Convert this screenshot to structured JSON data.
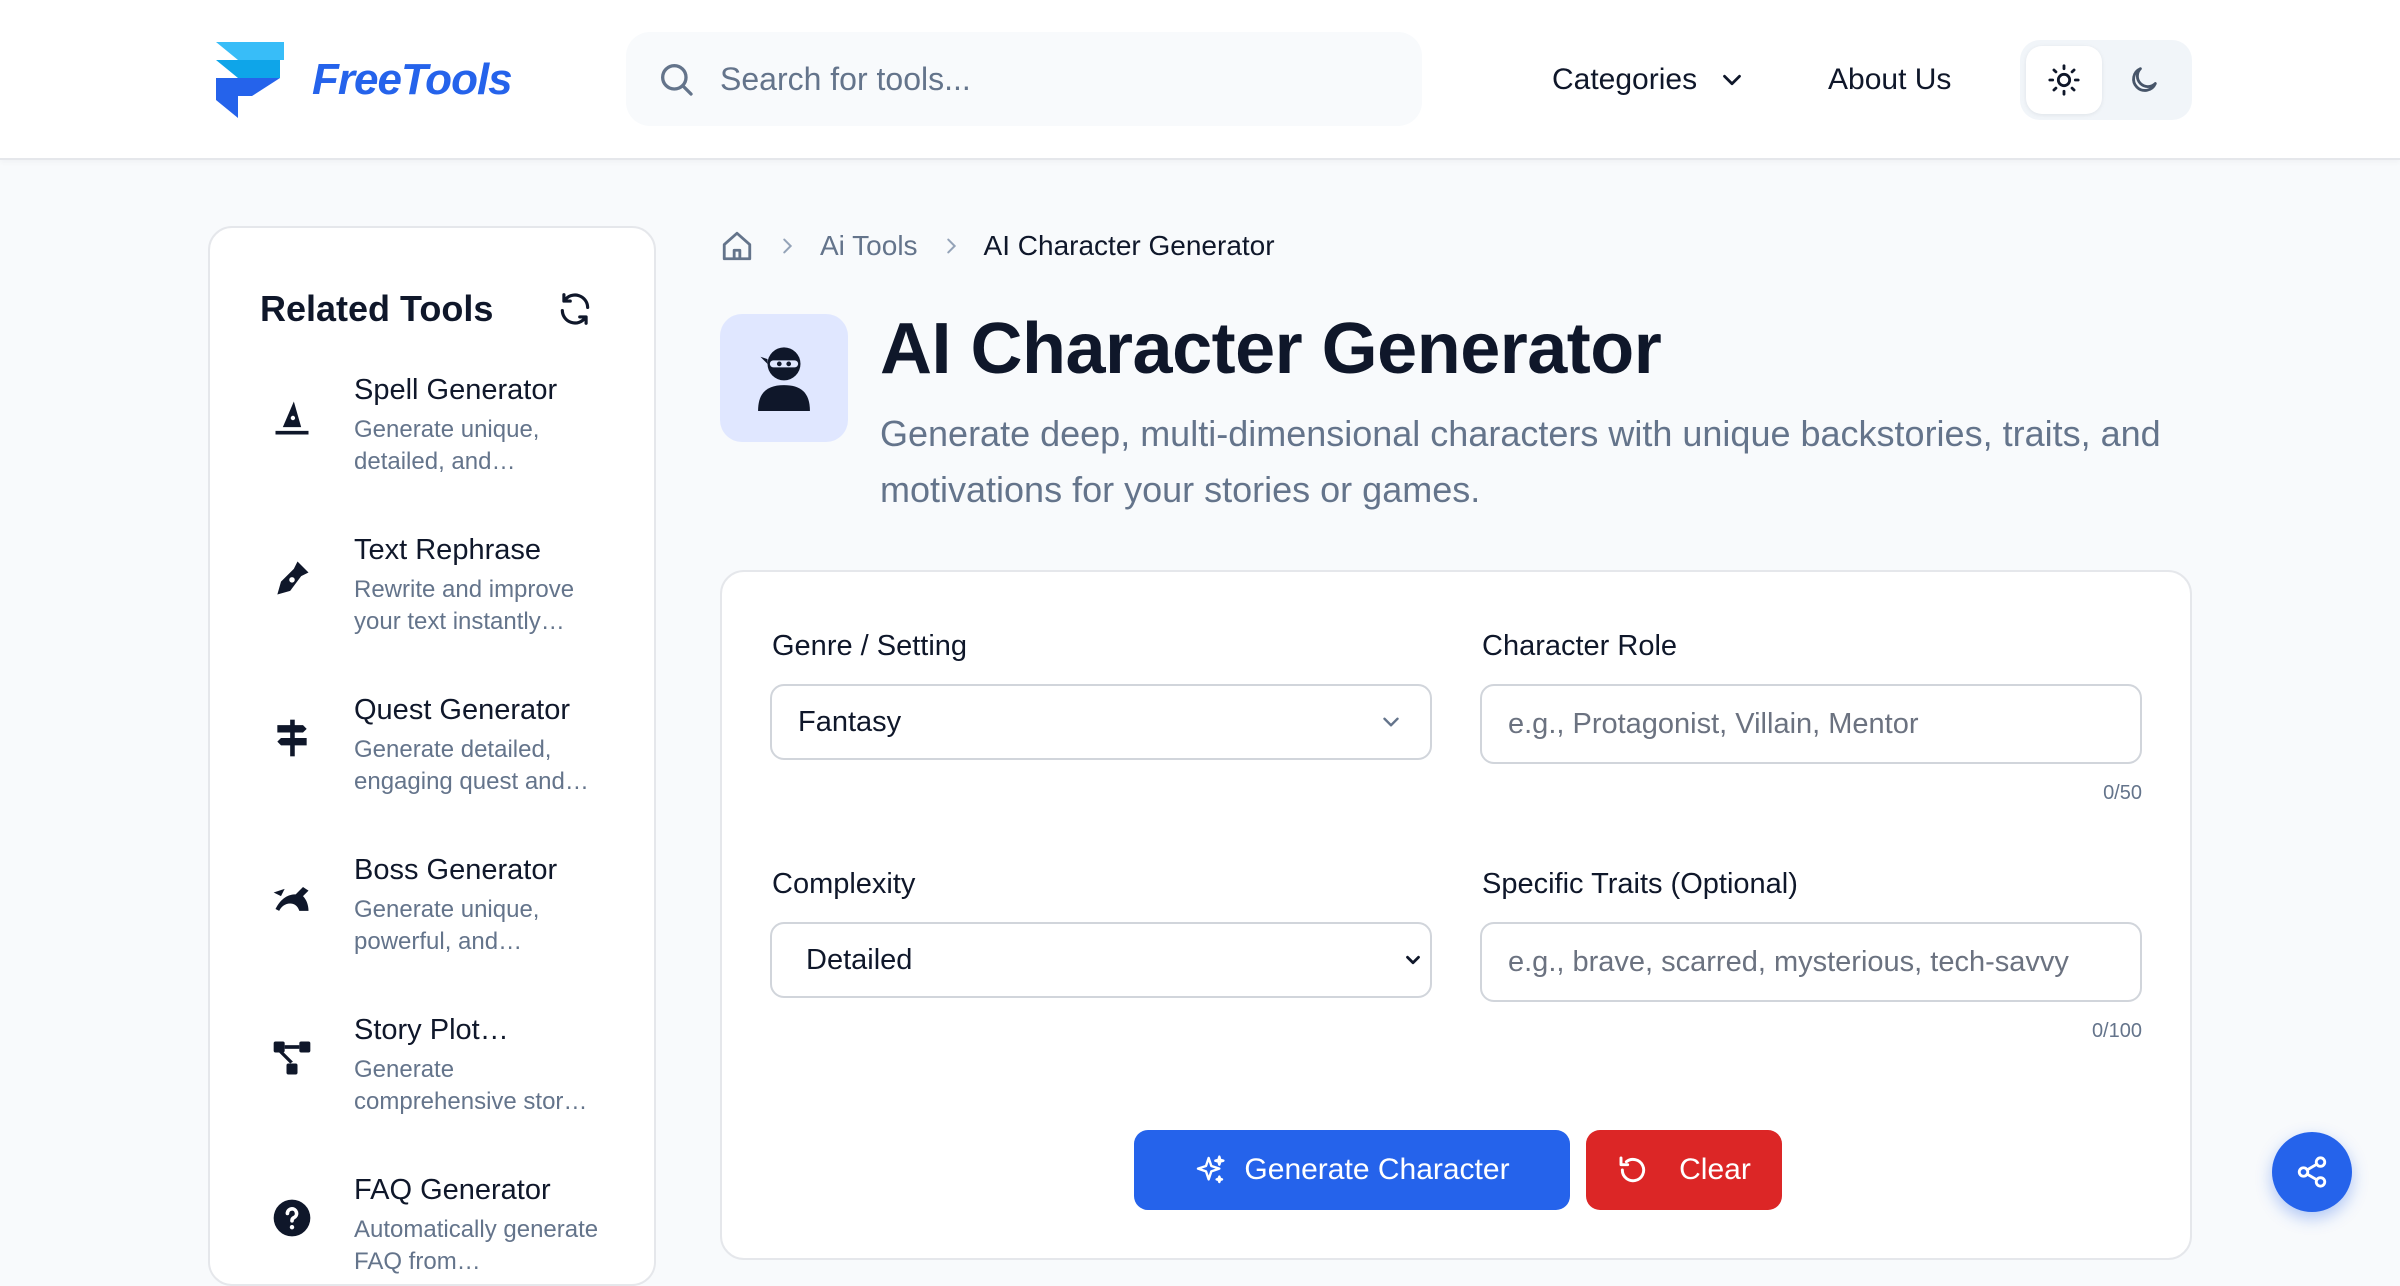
{
  "header": {
    "logo_text": "FreeTools",
    "search_placeholder": "Search for tools...",
    "nav": {
      "categories": "Categories",
      "about": "About Us"
    },
    "theme": {
      "selected": "light"
    }
  },
  "sidebar": {
    "title": "Related Tools",
    "items": [
      {
        "name": "Spell Generator",
        "desc": "Generate unique, detailed, and…",
        "icon": "wizard-hat-icon"
      },
      {
        "name": "Text Rephrase",
        "desc": "Rewrite and improve your text instantly…",
        "icon": "pen-nib-icon"
      },
      {
        "name": "Quest Generator",
        "desc": "Generate detailed, engaging quest and…",
        "icon": "signpost-icon"
      },
      {
        "name": "Boss Generator",
        "desc": "Generate unique, powerful, and…",
        "icon": "dragon-icon"
      },
      {
        "name": "Story Plot…",
        "desc": "Generate comprehensive stor…",
        "icon": "diagram-icon"
      },
      {
        "name": "FAQ Generator",
        "desc": "Automatically generate FAQ from…",
        "icon": "question-circle-icon"
      }
    ]
  },
  "breadcrumb": {
    "parent": "Ai Tools",
    "current": "AI Character Generator"
  },
  "page": {
    "title": "AI Character Generator",
    "subtitle": "Generate deep, multi-dimensional characters with unique backstories, traits, and motivations for your stories or games."
  },
  "form": {
    "genre": {
      "label": "Genre / Setting",
      "value": "Fantasy"
    },
    "role": {
      "label": "Character Role",
      "placeholder": "e.g., Protagonist, Villain, Mentor",
      "counter": "0/50"
    },
    "complexity": {
      "label": "Complexity",
      "value": "Detailed"
    },
    "traits": {
      "label": "Specific Traits (Optional)",
      "placeholder": "e.g., brave, scarred, mysterious, tech-savvy",
      "counter": "0/100"
    },
    "generate_label": "Generate Character",
    "clear_label": "Clear"
  },
  "colors": {
    "primary": "#2563eb",
    "danger": "#dc2626",
    "muted_text": "#64748b",
    "hero_icon_bg": "#e0e7ff"
  }
}
